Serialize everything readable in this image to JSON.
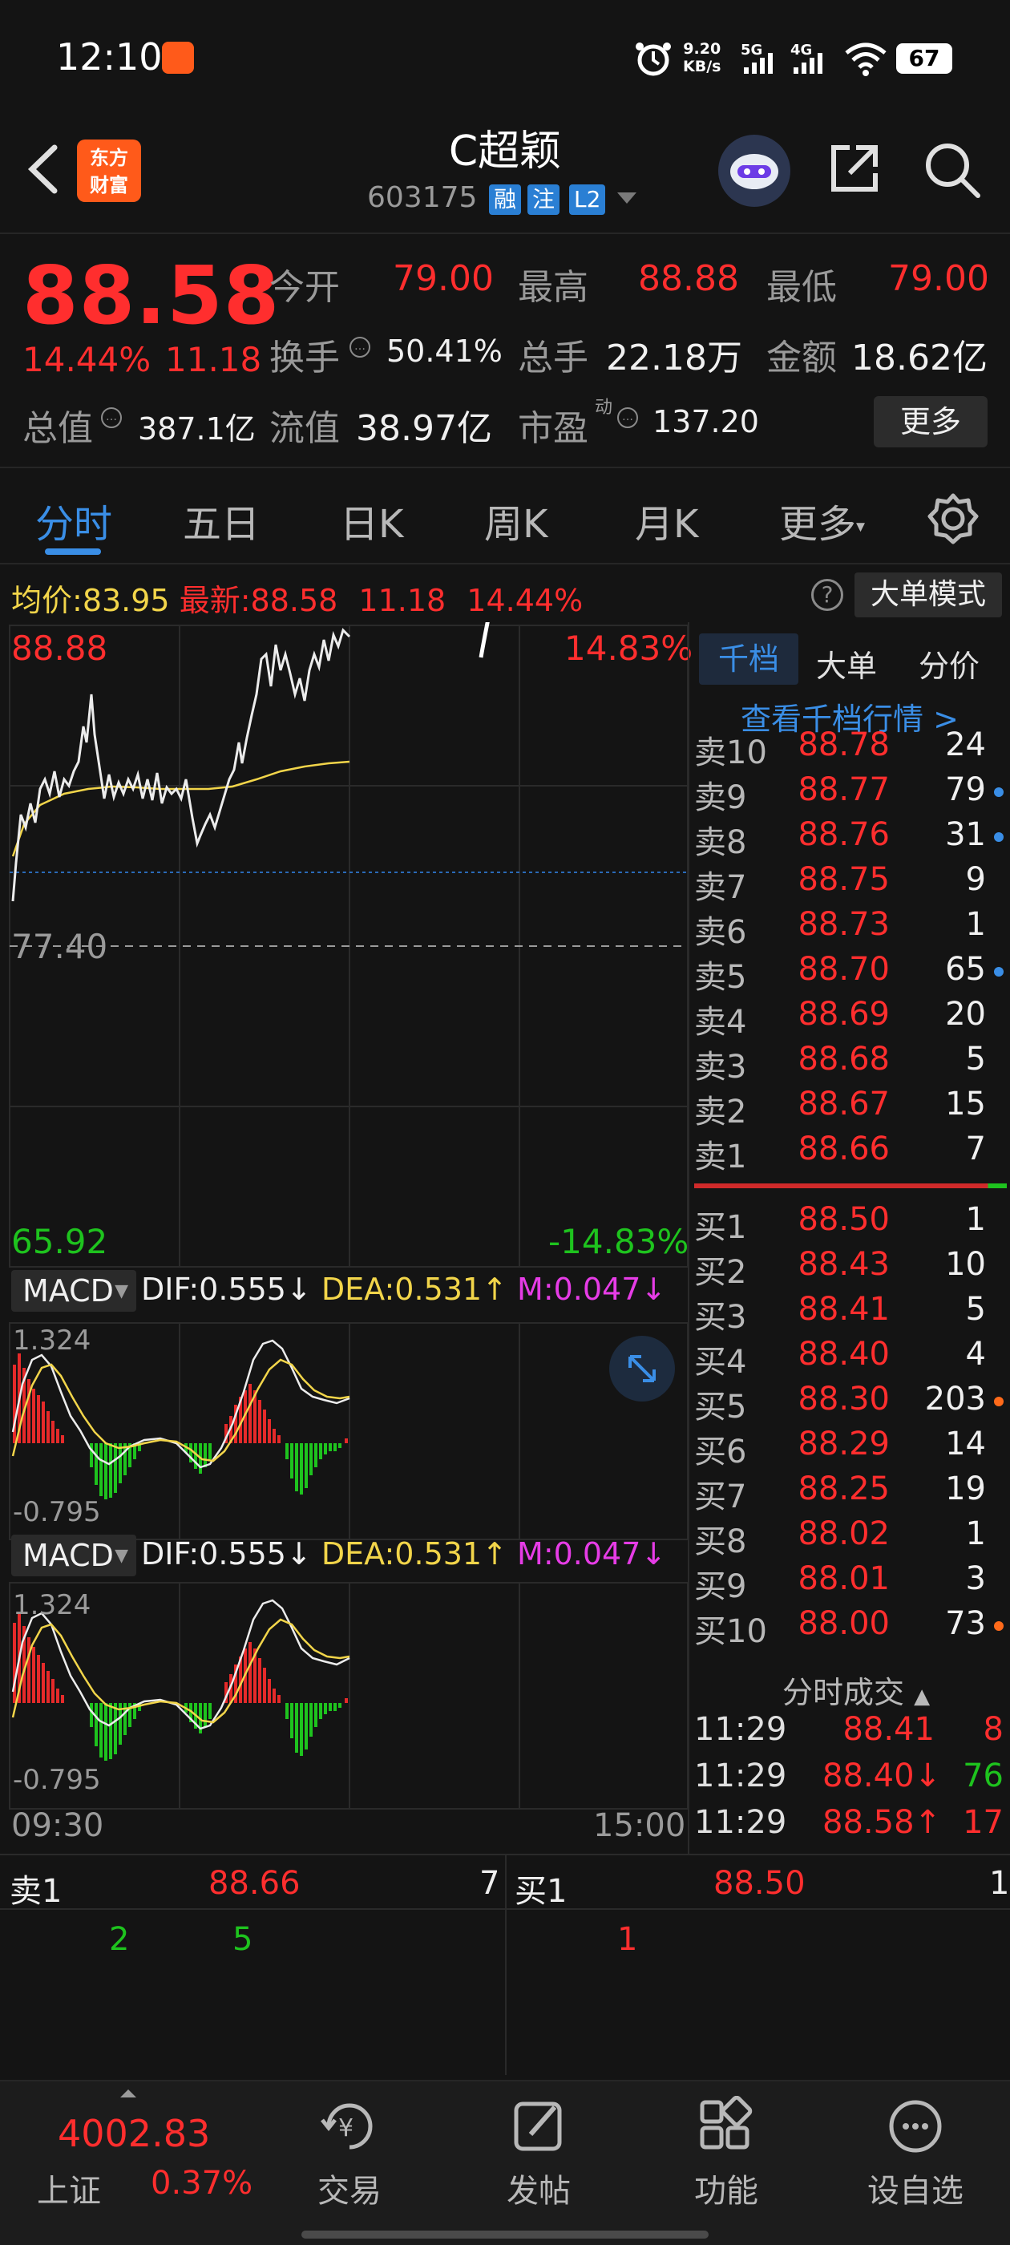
{
  "status_bar": {
    "time": "12:10",
    "net_speed_value": "9.20",
    "net_speed_unit": "KB/s",
    "signal_5g": "5G",
    "signal_4g": "4G",
    "battery": "67"
  },
  "header": {
    "logo_line1": "东方",
    "logo_line2": "财富",
    "stock_name": "C超颖",
    "stock_code": "603175",
    "tags": [
      "融",
      "注",
      "L2"
    ]
  },
  "quote": {
    "price": "88.58",
    "change_pct": "14.44%",
    "change": "11.18",
    "open_label": "今开",
    "open_value": "79.00",
    "high_label": "最高",
    "high_value": "88.88",
    "low_label": "最低",
    "low_value": "79.00",
    "turnover_label": "换手",
    "turnover_value": "50.41%",
    "volume_label": "总手",
    "volume_value": "22.18万",
    "amount_label": "金额",
    "amount_value": "18.62亿",
    "total_cap_label": "总值",
    "total_cap_value": "387.1亿",
    "float_cap_label": "流值",
    "float_cap_value": "38.97亿",
    "pe_label": "市盈",
    "pe_superscript": "动",
    "pe_value": "137.20",
    "more_button": "更多"
  },
  "tabs": [
    "分时",
    "五日",
    "日K",
    "周K",
    "月K",
    "更多"
  ],
  "chart_header": {
    "avg_label": "均价:",
    "avg_value": "83.95",
    "latest_label": "最新:",
    "latest_value": "88.58",
    "latest_change": "11.18",
    "latest_pct": "14.44%",
    "big_order_button": "大单模式",
    "help": "?"
  },
  "chart_labels": {
    "high_price": "88.88",
    "high_pct": "14.83%",
    "prev_close": "77.40",
    "low_price": "65.92",
    "low_pct": "-14.83%",
    "time_start": "09:30",
    "time_end": "15:00"
  },
  "macd": {
    "name": "MACD",
    "dif": "DIF:0.555",
    "dea": "DEA:0.531",
    "m": "M:0.047",
    "top": "1.324",
    "bottom": "-0.795"
  },
  "order_book": {
    "tabs": [
      "千档",
      "大单",
      "分价"
    ],
    "link": "查看千档行情 >",
    "asks": [
      {
        "label": "卖10",
        "price": "88.78",
        "volume": "24",
        "dot": ""
      },
      {
        "label": "卖9",
        "price": "88.77",
        "volume": "79",
        "dot": "#3a8ee6"
      },
      {
        "label": "卖8",
        "price": "88.76",
        "volume": "31",
        "dot": "#3a8ee6"
      },
      {
        "label": "卖7",
        "price": "88.75",
        "volume": "9",
        "dot": ""
      },
      {
        "label": "卖6",
        "price": "88.73",
        "volume": "1",
        "dot": ""
      },
      {
        "label": "卖5",
        "price": "88.70",
        "volume": "65",
        "dot": "#3a8ee6"
      },
      {
        "label": "卖4",
        "price": "88.69",
        "volume": "20",
        "dot": ""
      },
      {
        "label": "卖3",
        "price": "88.68",
        "volume": "5",
        "dot": ""
      },
      {
        "label": "卖2",
        "price": "88.67",
        "volume": "15",
        "dot": ""
      },
      {
        "label": "卖1",
        "price": "88.66",
        "volume": "7",
        "dot": ""
      }
    ],
    "bids": [
      {
        "label": "买1",
        "price": "88.50",
        "volume": "1",
        "dot": ""
      },
      {
        "label": "买2",
        "price": "88.43",
        "volume": "10",
        "dot": ""
      },
      {
        "label": "买3",
        "price": "88.41",
        "volume": "5",
        "dot": ""
      },
      {
        "label": "买4",
        "price": "88.40",
        "volume": "4",
        "dot": ""
      },
      {
        "label": "买5",
        "price": "88.30",
        "volume": "203",
        "dot": "#ff6a1a"
      },
      {
        "label": "买6",
        "price": "88.29",
        "volume": "14",
        "dot": ""
      },
      {
        "label": "买7",
        "price": "88.25",
        "volume": "19",
        "dot": ""
      },
      {
        "label": "买8",
        "price": "88.02",
        "volume": "1",
        "dot": ""
      },
      {
        "label": "买9",
        "price": "88.01",
        "volume": "3",
        "dot": ""
      },
      {
        "label": "买10",
        "price": "88.00",
        "volume": "73",
        "dot": "#ff6a1a"
      }
    ],
    "tick_title": "分时成交",
    "ticks": [
      {
        "time": "11:29",
        "price": "88.41",
        "volume": "8",
        "color": "#ff2e2e"
      },
      {
        "time": "11:29",
        "price": "88.40↓",
        "volume": "76",
        "color": "#1ec31e"
      },
      {
        "time": "11:29",
        "price": "88.58↑",
        "volume": "17",
        "color": "#ff2e2e"
      }
    ]
  },
  "strip": {
    "ask_label": "卖1",
    "ask_price": "88.66",
    "ask_volume": "7",
    "bid_label": "买1",
    "bid_price": "88.50",
    "bid_volume": "1",
    "ask_queue": [
      "2",
      "5"
    ],
    "bid_queue": [
      "1"
    ]
  },
  "nav": {
    "index_value": "4002.83",
    "index_name": "上证",
    "index_pct": "0.37%",
    "items": [
      "交易",
      "发帖",
      "功能",
      "设自选"
    ]
  }
}
